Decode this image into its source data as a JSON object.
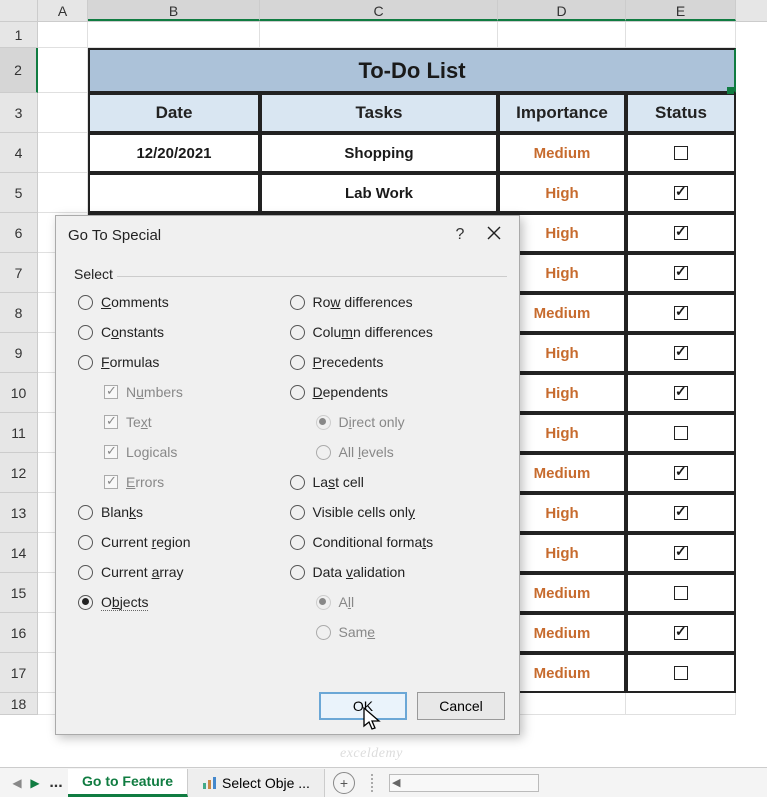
{
  "columns": [
    "A",
    "B",
    "C",
    "D",
    "E"
  ],
  "title": "To-Do List",
  "headers": {
    "date": "Date",
    "tasks": "Tasks",
    "importance": "Importance",
    "status": "Status"
  },
  "rows": [
    {
      "date": "12/20/2021",
      "task": "Shopping",
      "importance": "Medium",
      "checked": false
    },
    {
      "date": "",
      "task": "Lab Work",
      "importance": "High",
      "checked": true
    },
    {
      "date": "",
      "task": "",
      "importance": "High",
      "checked": true
    },
    {
      "date": "",
      "task": "",
      "importance": "High",
      "checked": true
    },
    {
      "date": "",
      "task": "",
      "importance": "Medium",
      "checked": true
    },
    {
      "date": "",
      "task": "",
      "importance": "High",
      "checked": true
    },
    {
      "date": "",
      "task": "",
      "importance": "High",
      "checked": true
    },
    {
      "date": "",
      "task": "",
      "importance": "High",
      "checked": false
    },
    {
      "date": "",
      "task": "",
      "importance": "Medium",
      "checked": true
    },
    {
      "date": "",
      "task": "",
      "importance": "High",
      "checked": true
    },
    {
      "date": "",
      "task": "",
      "importance": "High",
      "checked": true
    },
    {
      "date": "",
      "task": "",
      "importance": "Medium",
      "checked": false
    },
    {
      "date": "",
      "task": "",
      "importance": "Medium",
      "checked": true
    },
    {
      "date": "",
      "task": "",
      "importance": "Medium",
      "checked": false
    }
  ],
  "dialog": {
    "title": "Go To Special",
    "help": "?",
    "fieldset_label": "Select",
    "left": {
      "comments": "Comments",
      "constants": "Constants",
      "formulas": "Formulas",
      "numbers": "Numbers",
      "text": "Text",
      "logicals": "Logicals",
      "errors": "Errors",
      "blanks": "Blanks",
      "current_region": "Current region",
      "current_array": "Current array",
      "objects": "Objects"
    },
    "right": {
      "row_diff": "Row differences",
      "col_diff": "Column differences",
      "precedents": "Precedents",
      "dependents": "Dependents",
      "direct_only": "Direct only",
      "all_levels": "All levels",
      "last_cell": "Last cell",
      "visible": "Visible cells only",
      "conditional": "Conditional formats",
      "validation": "Data validation",
      "all": "All",
      "same": "Same"
    },
    "ok": "OK",
    "cancel": "Cancel"
  },
  "tabs": {
    "ellipsis": "...",
    "active": "Go to Feature",
    "next": "Select Obje ...",
    "new": "+"
  },
  "watermark": "exceldemy"
}
